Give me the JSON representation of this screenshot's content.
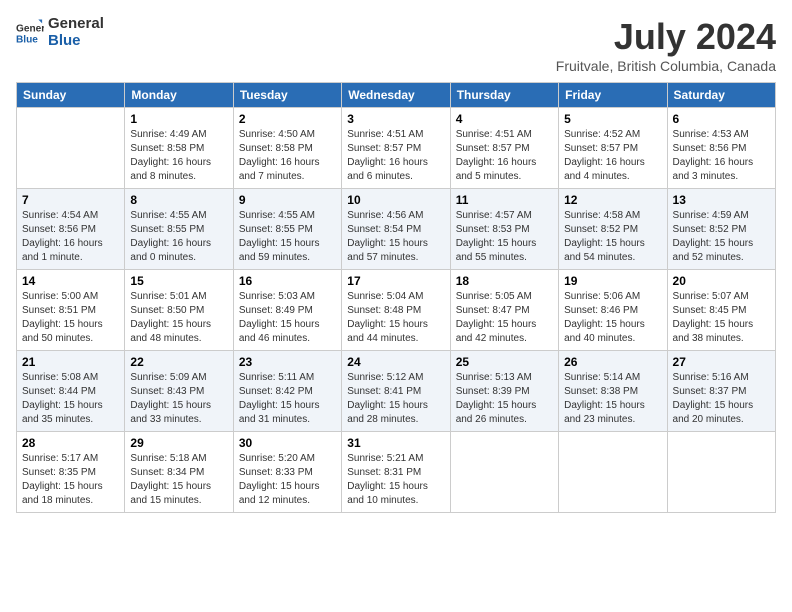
{
  "logo": {
    "line1": "General",
    "line2": "Blue"
  },
  "title": "July 2024",
  "location": "Fruitvale, British Columbia, Canada",
  "days_header": [
    "Sunday",
    "Monday",
    "Tuesday",
    "Wednesday",
    "Thursday",
    "Friday",
    "Saturday"
  ],
  "weeks": [
    [
      {
        "day": "",
        "detail": ""
      },
      {
        "day": "1",
        "detail": "Sunrise: 4:49 AM\nSunset: 8:58 PM\nDaylight: 16 hours\nand 8 minutes."
      },
      {
        "day": "2",
        "detail": "Sunrise: 4:50 AM\nSunset: 8:58 PM\nDaylight: 16 hours\nand 7 minutes."
      },
      {
        "day": "3",
        "detail": "Sunrise: 4:51 AM\nSunset: 8:57 PM\nDaylight: 16 hours\nand 6 minutes."
      },
      {
        "day": "4",
        "detail": "Sunrise: 4:51 AM\nSunset: 8:57 PM\nDaylight: 16 hours\nand 5 minutes."
      },
      {
        "day": "5",
        "detail": "Sunrise: 4:52 AM\nSunset: 8:57 PM\nDaylight: 16 hours\nand 4 minutes."
      },
      {
        "day": "6",
        "detail": "Sunrise: 4:53 AM\nSunset: 8:56 PM\nDaylight: 16 hours\nand 3 minutes."
      }
    ],
    [
      {
        "day": "7",
        "detail": "Sunrise: 4:54 AM\nSunset: 8:56 PM\nDaylight: 16 hours\nand 1 minute."
      },
      {
        "day": "8",
        "detail": "Sunrise: 4:55 AM\nSunset: 8:55 PM\nDaylight: 16 hours\nand 0 minutes."
      },
      {
        "day": "9",
        "detail": "Sunrise: 4:55 AM\nSunset: 8:55 PM\nDaylight: 15 hours\nand 59 minutes."
      },
      {
        "day": "10",
        "detail": "Sunrise: 4:56 AM\nSunset: 8:54 PM\nDaylight: 15 hours\nand 57 minutes."
      },
      {
        "day": "11",
        "detail": "Sunrise: 4:57 AM\nSunset: 8:53 PM\nDaylight: 15 hours\nand 55 minutes."
      },
      {
        "day": "12",
        "detail": "Sunrise: 4:58 AM\nSunset: 8:52 PM\nDaylight: 15 hours\nand 54 minutes."
      },
      {
        "day": "13",
        "detail": "Sunrise: 4:59 AM\nSunset: 8:52 PM\nDaylight: 15 hours\nand 52 minutes."
      }
    ],
    [
      {
        "day": "14",
        "detail": "Sunrise: 5:00 AM\nSunset: 8:51 PM\nDaylight: 15 hours\nand 50 minutes."
      },
      {
        "day": "15",
        "detail": "Sunrise: 5:01 AM\nSunset: 8:50 PM\nDaylight: 15 hours\nand 48 minutes."
      },
      {
        "day": "16",
        "detail": "Sunrise: 5:03 AM\nSunset: 8:49 PM\nDaylight: 15 hours\nand 46 minutes."
      },
      {
        "day": "17",
        "detail": "Sunrise: 5:04 AM\nSunset: 8:48 PM\nDaylight: 15 hours\nand 44 minutes."
      },
      {
        "day": "18",
        "detail": "Sunrise: 5:05 AM\nSunset: 8:47 PM\nDaylight: 15 hours\nand 42 minutes."
      },
      {
        "day": "19",
        "detail": "Sunrise: 5:06 AM\nSunset: 8:46 PM\nDaylight: 15 hours\nand 40 minutes."
      },
      {
        "day": "20",
        "detail": "Sunrise: 5:07 AM\nSunset: 8:45 PM\nDaylight: 15 hours\nand 38 minutes."
      }
    ],
    [
      {
        "day": "21",
        "detail": "Sunrise: 5:08 AM\nSunset: 8:44 PM\nDaylight: 15 hours\nand 35 minutes."
      },
      {
        "day": "22",
        "detail": "Sunrise: 5:09 AM\nSunset: 8:43 PM\nDaylight: 15 hours\nand 33 minutes."
      },
      {
        "day": "23",
        "detail": "Sunrise: 5:11 AM\nSunset: 8:42 PM\nDaylight: 15 hours\nand 31 minutes."
      },
      {
        "day": "24",
        "detail": "Sunrise: 5:12 AM\nSunset: 8:41 PM\nDaylight: 15 hours\nand 28 minutes."
      },
      {
        "day": "25",
        "detail": "Sunrise: 5:13 AM\nSunset: 8:39 PM\nDaylight: 15 hours\nand 26 minutes."
      },
      {
        "day": "26",
        "detail": "Sunrise: 5:14 AM\nSunset: 8:38 PM\nDaylight: 15 hours\nand 23 minutes."
      },
      {
        "day": "27",
        "detail": "Sunrise: 5:16 AM\nSunset: 8:37 PM\nDaylight: 15 hours\nand 20 minutes."
      }
    ],
    [
      {
        "day": "28",
        "detail": "Sunrise: 5:17 AM\nSunset: 8:35 PM\nDaylight: 15 hours\nand 18 minutes."
      },
      {
        "day": "29",
        "detail": "Sunrise: 5:18 AM\nSunset: 8:34 PM\nDaylight: 15 hours\nand 15 minutes."
      },
      {
        "day": "30",
        "detail": "Sunrise: 5:20 AM\nSunset: 8:33 PM\nDaylight: 15 hours\nand 12 minutes."
      },
      {
        "day": "31",
        "detail": "Sunrise: 5:21 AM\nSunset: 8:31 PM\nDaylight: 15 hours\nand 10 minutes."
      },
      {
        "day": "",
        "detail": ""
      },
      {
        "day": "",
        "detail": ""
      },
      {
        "day": "",
        "detail": ""
      }
    ]
  ]
}
